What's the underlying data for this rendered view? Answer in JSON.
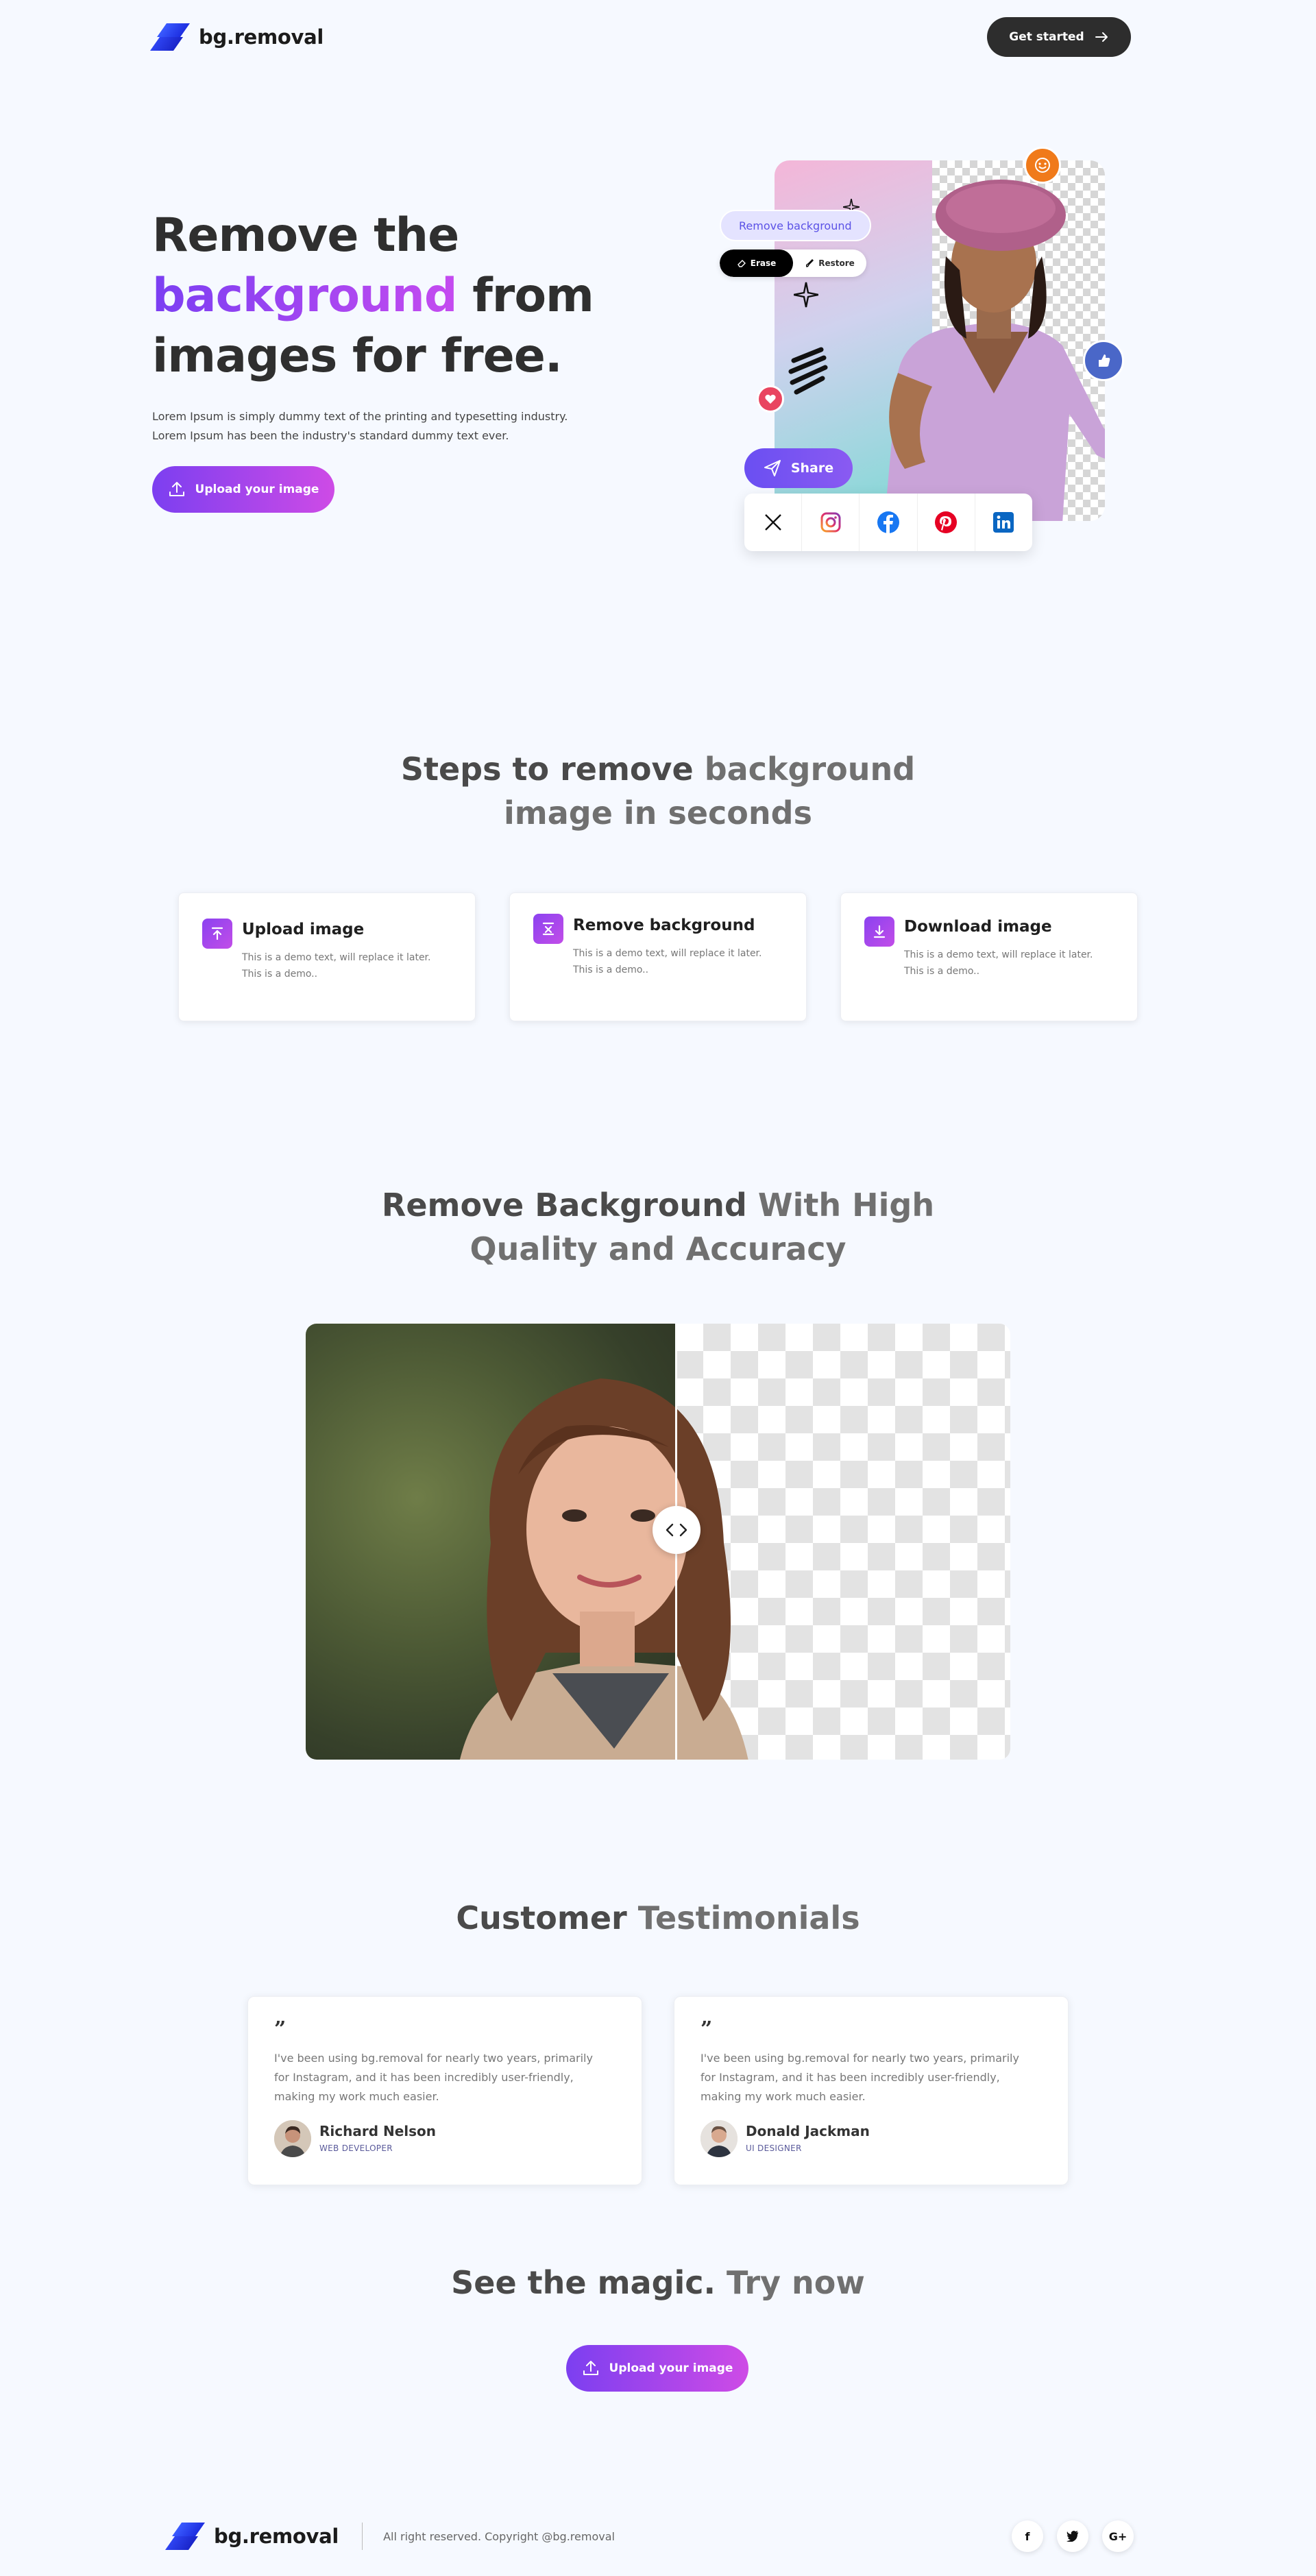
{
  "nav": {
    "brand": "bg.removal",
    "cta_label": "Get started"
  },
  "hero": {
    "title_line1": "Remove the",
    "title_highlight": "background",
    "title_after_highlight": " from",
    "title_line3": "images for free.",
    "description_line1": "Lorem Ipsum is simply dummy text of the printing and typesetting industry.",
    "description_line2": "Lorem Ipsum has been the industry's standard dummy text ever.",
    "upload_label": "Upload your image",
    "visual": {
      "remove_chip": "Remove background",
      "erase_label": "Erase",
      "restore_label": "Restore",
      "share_label": "Share",
      "social_icons": [
        "x-icon",
        "instagram-icon",
        "facebook-icon",
        "pinterest-icon",
        "linkedin-icon"
      ]
    }
  },
  "steps": {
    "title_dark": "Steps to remove ",
    "title_muted": "background",
    "title_line2": "image in seconds",
    "items": [
      {
        "title": "Upload image",
        "desc": "This is a demo text, will replace it later. This is a demo..",
        "icon": "upload-icon"
      },
      {
        "title": "Remove background",
        "desc": "This is a demo text, will replace it later. This is a demo..",
        "icon": "remove-icon"
      },
      {
        "title": "Download image",
        "desc": "This is a demo text, will replace it later. This is a demo..",
        "icon": "download-icon"
      }
    ]
  },
  "quality": {
    "title_dark": "Remove Background ",
    "title_muted": "With High",
    "title_line2": "Quality and Accuracy"
  },
  "testimonials": {
    "title_dark": "Customer ",
    "title_muted": "Testimonials",
    "items": [
      {
        "quote_mark": "”",
        "text": "I've been using bg.removal for nearly two years, primarily for Instagram, and it has been incredibly user-friendly, making my work much easier.",
        "name": "Richard Nelson",
        "role": "WEB DEVELOPER"
      },
      {
        "quote_mark": "”",
        "text": "I've been using bg.removal for nearly two years, primarily for Instagram, and it has been incredibly user-friendly, making my work much easier.",
        "name": "Donald Jackman",
        "role": "UI DESIGNER"
      }
    ]
  },
  "cta": {
    "title_dark": "See the magic. ",
    "title_muted": "Try now",
    "upload_label": "Upload your image"
  },
  "footer": {
    "brand": "bg.removal",
    "copyright": "All right reserved. Copyright @bg.removal",
    "socials": [
      "f",
      "t",
      "G+"
    ]
  },
  "colors": {
    "accent_start": "#7c3ff0",
    "accent_end": "#ce4be6",
    "background": "#f6f9ff",
    "dark_button": "#2d2d2d"
  }
}
